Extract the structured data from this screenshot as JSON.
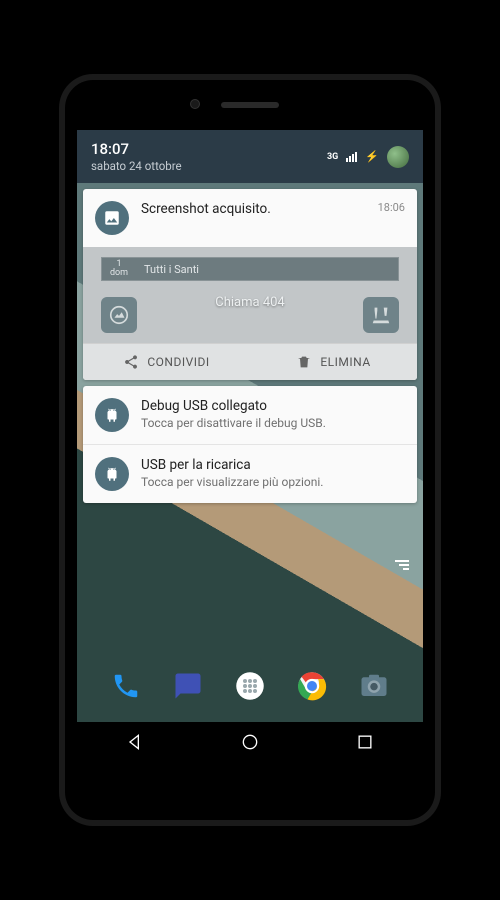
{
  "status": {
    "time": "18:07",
    "date": "sabato 24 ottobre",
    "net_label": "3G"
  },
  "notif1": {
    "title": "Screenshot acquisito.",
    "timestamp": "18:06"
  },
  "preview": {
    "day_num": "1",
    "day_name": "dom",
    "event": "Tutti i Santi",
    "center": "Chiama 404"
  },
  "actions": {
    "share": "CONDIVIDI",
    "delete": "ELIMINA"
  },
  "notif2": {
    "title": "Debug USB collegato",
    "body": "Tocca per disattivare il debug USB."
  },
  "notif3": {
    "title": "USB per la ricarica",
    "body": "Tocca per visualizzare più opzioni."
  }
}
